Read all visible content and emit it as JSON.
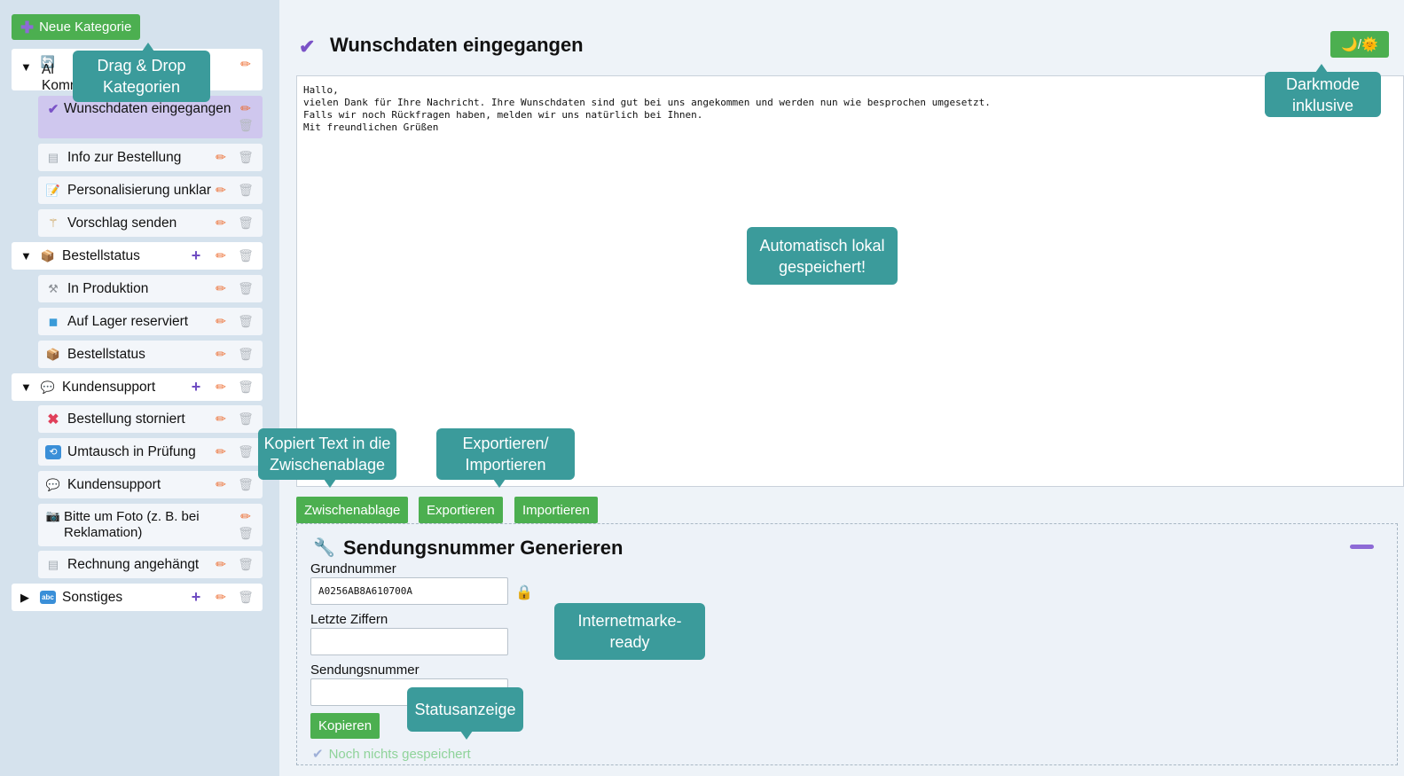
{
  "sidebar": {
    "new_category_label": "Neue Kategorie",
    "categories": [
      {
        "label": "Allgemeine Kommunikation",
        "label_visible": "Al\nKomm",
        "expanded": true,
        "icon": "refresh-icon",
        "items": [
          {
            "label": "Wunschdaten eingegangen",
            "icon": "checkmark-icon",
            "active": true
          },
          {
            "label": "Info zur Bestellung",
            "icon": "document-icon"
          },
          {
            "label": "Personalisierung unklar",
            "icon": "memo-icon"
          },
          {
            "label": "Vorschlag senden",
            "icon": "magic-wand-icon"
          }
        ]
      },
      {
        "label": "Bestellstatus",
        "expanded": true,
        "icon": "package-icon",
        "items": [
          {
            "label": "In Produktion",
            "icon": "tools-icon"
          },
          {
            "label": "Auf Lager reserviert",
            "icon": "cube-icon"
          },
          {
            "label": "Bestellstatus",
            "icon": "package-icon"
          }
        ]
      },
      {
        "label": "Kundensupport",
        "expanded": true,
        "icon": "speech-bubble-icon",
        "items": [
          {
            "label": "Bestellung storniert",
            "icon": "cross-mark-icon"
          },
          {
            "label": "Umtausch in Prüfung",
            "icon": "repeat-icon"
          },
          {
            "label": "Kundensupport",
            "icon": "speech-bubble-icon"
          },
          {
            "label": "Bitte um Foto (z. B. bei Reklamation)",
            "icon": "camera-icon"
          },
          {
            "label": "Rechnung angehängt",
            "icon": "document-icon"
          }
        ]
      },
      {
        "label": "Sonstiges",
        "expanded": false,
        "icon": "abc-icon",
        "items": []
      }
    ]
  },
  "main": {
    "title": "Wunschdaten eingegangen",
    "darkmode_label": "🌙/🌞",
    "editor_text": "Hallo,\nvielen Dank für Ihre Nachricht. Ihre Wunschdaten sind gut bei uns angekommen und werden nun wie besprochen umgesetzt.\nFalls wir noch Rückfragen haben, melden wir uns natürlich bei Ihnen.\nMit freundlichen Grüßen",
    "buttons": {
      "clipboard": "Zwischenablage",
      "export": "Exportieren",
      "import": "Importieren"
    }
  },
  "generator": {
    "title": "Sendungsnummer Generieren",
    "base_label": "Grundnummer",
    "base_value": "A0256AB8A610700A",
    "last_digits_label": "Letzte Ziffern",
    "last_digits_value": "",
    "tracking_label": "Sendungsnummer",
    "tracking_value": "",
    "copy_label": "Kopieren",
    "status_text": "Noch nichts gespeichert"
  },
  "tooltips": {
    "drag_drop": "Drag & Drop\nKategorien",
    "darkmode": "Darkmode\ninklusive",
    "autosave": "Automatisch lokal\ngespeichert!",
    "clipboard": "Kopiert Text in die\nZwischenablage",
    "export_import": "Exportieren/\nImportieren",
    "internetmarke": "Internetmarke-ready",
    "status": "Statusanzeige"
  },
  "colors": {
    "accent_green": "#4caf50",
    "accent_purple": "#7a52c7",
    "tooltip_teal": "#3b9b9b",
    "sidebar_bg": "#d5e2ed",
    "active_item_bg": "#cfc7ee"
  }
}
